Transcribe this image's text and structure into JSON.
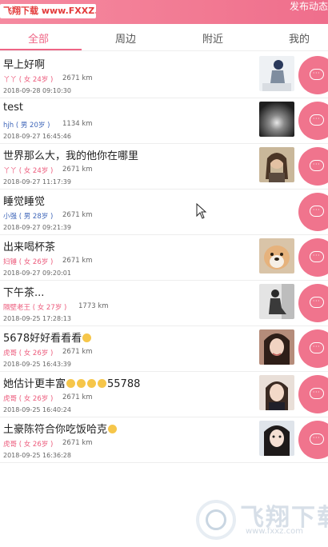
{
  "header": {
    "watermark_url": "飞翔下载 www.FXXZ.com",
    "post_label": "发布动态"
  },
  "tabs": [
    {
      "label": "全部",
      "active": true
    },
    {
      "label": "周边",
      "active": false
    },
    {
      "label": "附近",
      "active": false
    },
    {
      "label": "我的",
      "active": false
    }
  ],
  "posts": [
    {
      "title": "早上好啊",
      "user": "丫丫 ( 女 24岁 )",
      "gender": "female",
      "distance": "2671 km",
      "time": "2018-09-28 09:10:30",
      "thumb": "person-walking"
    },
    {
      "title": "test",
      "user": "hjh ( 男 20岁 )",
      "gender": "male",
      "distance": "1134 km",
      "time": "2018-09-27 16:45:46",
      "thumb": "dark-light"
    },
    {
      "title": "世界那么大，我的他你在哪里",
      "user": "丫丫 ( 女 24岁 )",
      "gender": "female",
      "distance": "2671 km",
      "time": "2018-09-27 11:17:39",
      "thumb": "woman-portrait"
    },
    {
      "title": "睡觉睡觉",
      "user": "小强 ( 男 28岁 )",
      "gender": "male",
      "distance": "2671 km",
      "time": "2018-09-27 09:21:39",
      "thumb": ""
    },
    {
      "title": "出来喝杯茶",
      "user": "妇锤 ( 女 26岁 )",
      "gender": "female",
      "distance": "2671 km",
      "time": "2018-09-27 09:20:01",
      "thumb": "dog"
    },
    {
      "title": "下午茶...",
      "user": "隔壁老王 ( 女 27岁 )",
      "gender": "female",
      "distance": "1773 km",
      "time": "2018-09-25 17:28:13",
      "thumb": "person-sitting"
    },
    {
      "title": "5678好好看看看",
      "user": "虎哥 ( 女 26岁 )",
      "gender": "female",
      "distance": "2671 km",
      "time": "2018-09-25 16:43:39",
      "thumb": "woman-portrait",
      "emojis": 1
    },
    {
      "title": "她估计更丰富",
      "title_suffix": "55788",
      "user": "虎哥 ( 女 26岁 )",
      "gender": "female",
      "distance": "2671 km",
      "time": "2018-09-25 16:40:24",
      "thumb": "woman-portrait",
      "emojis": 4
    },
    {
      "title": "土豪陈符合你吃饭哈克",
      "user": "虎哥 ( 女 26岁 )",
      "gender": "female",
      "distance": "2671 km",
      "time": "2018-09-25 16:36:28",
      "thumb": "woman-portrait",
      "emojis": 1
    }
  ],
  "watermark": {
    "title": "飞翔下载",
    "url": "www.fxxz.com"
  },
  "colors": {
    "accent": "#ef6585",
    "female": "#ec5a7b",
    "male": "#3f66b9"
  }
}
